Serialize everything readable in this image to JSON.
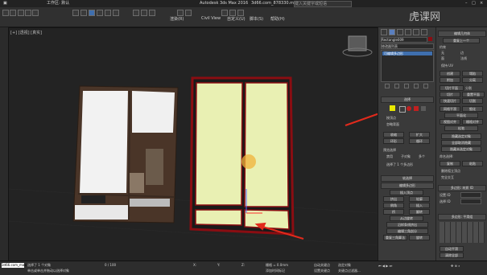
{
  "app": {
    "title": "Autodesk 3ds Max 2016",
    "file": "3d66.com_878330.max",
    "search_placeholder": "键入关键字或短语",
    "workspace": "工作区: 默认"
  },
  "menu": {
    "items": [
      "渲染(R)",
      "Civil View",
      "自定义(U)",
      "脚本(S)",
      "帮助(H)"
    ]
  },
  "viewport": {
    "label": "[+] [透视] [真实]"
  },
  "command_panel": {
    "object_name": "Rectangle009",
    "modifier_list": "修改器列表",
    "stack_item": "可编辑多边形",
    "selection_title": "选择",
    "by_vertex": "按顶点",
    "ignore_backfacing": "忽略背面",
    "shrink": "收缩",
    "grow": "扩大",
    "ring": "环形",
    "loop": "循环",
    "preview_selection": "预览选择",
    "disabled": "禁用",
    "subobject": "子对象",
    "multi": "多个",
    "selected_count": "选择了 1 个多边形",
    "soft_selection": "软选择",
    "edit_polygons": "编辑多边形",
    "insert_vertex": "插入顶点",
    "extrude": "挤出",
    "outline": "轮廓",
    "bevel": "倒角",
    "inset": "插入",
    "bridge": "桥",
    "flip": "翻转",
    "from_edge_rotate": "从边旋转",
    "along_spline_extrude": "沿样条线挤出",
    "edit_triangulation": "编辑三角剖分",
    "retriangulate": "重复三角算法",
    "turn": "旋转"
  },
  "right_panel": {
    "title": "编辑几何体",
    "repeat_last": "重复上一个",
    "constraints": "约束",
    "none": "无",
    "edge": "边",
    "face": "面",
    "normal": "法线",
    "preserve_uvs": "保持 UV",
    "create": "创建",
    "collapse": "塌陷",
    "attach": "附加",
    "detach": "分离",
    "slice_plane": "切片平面",
    "split": "分割",
    "slice": "切片",
    "reset_plane": "重置平面",
    "quickslice": "快速切片",
    "cut": "切割",
    "msmooth": "网格平滑",
    "tessellate": "细化",
    "make_planar": "平面化",
    "view_align": "视图对齐",
    "grid_align": "栅格对齐",
    "relax": "松弛",
    "hide_selected": "隐藏选定对象",
    "unhide_all": "全部取消隐藏",
    "hide_unselected": "隐藏未选定对象",
    "named_selections": "命名选择:",
    "copy": "复制",
    "paste": "粘贴",
    "delete_isolated": "删除孤立顶点",
    "full_interactivity": "完全交互",
    "polygon_material": "多边形: 材质 ID",
    "set_id": "设置 ID",
    "select_id": "选择 ID",
    "smoothing_groups": "多边形: 平滑组",
    "auto_smooth": "自动平滑",
    "clear_all": "清除全部"
  },
  "status": {
    "selected": "选择了 1 个对象",
    "hint": "单击或单击并拖动以选择对象",
    "frames": "0 / 100",
    "x_label": "X:",
    "y_label": "Y:",
    "z_label": "Z:",
    "grid": "栅格 = 0.0mm",
    "autokey": "自动关键点",
    "selected_filter": "选定对象",
    "add_time_tag": "添加时间标记",
    "set_key": "设置关键点",
    "key_filters": "关键点过滤器...",
    "script_box": "3d66.com_max"
  },
  "watermark": "虎课网",
  "colors": {
    "selection_red": "#8a0d12",
    "panel_yellow": "#e8e800",
    "highlight_fill": "#e9f0b3",
    "wood": "#4a3528",
    "arrow_red": "#e12a1c"
  }
}
